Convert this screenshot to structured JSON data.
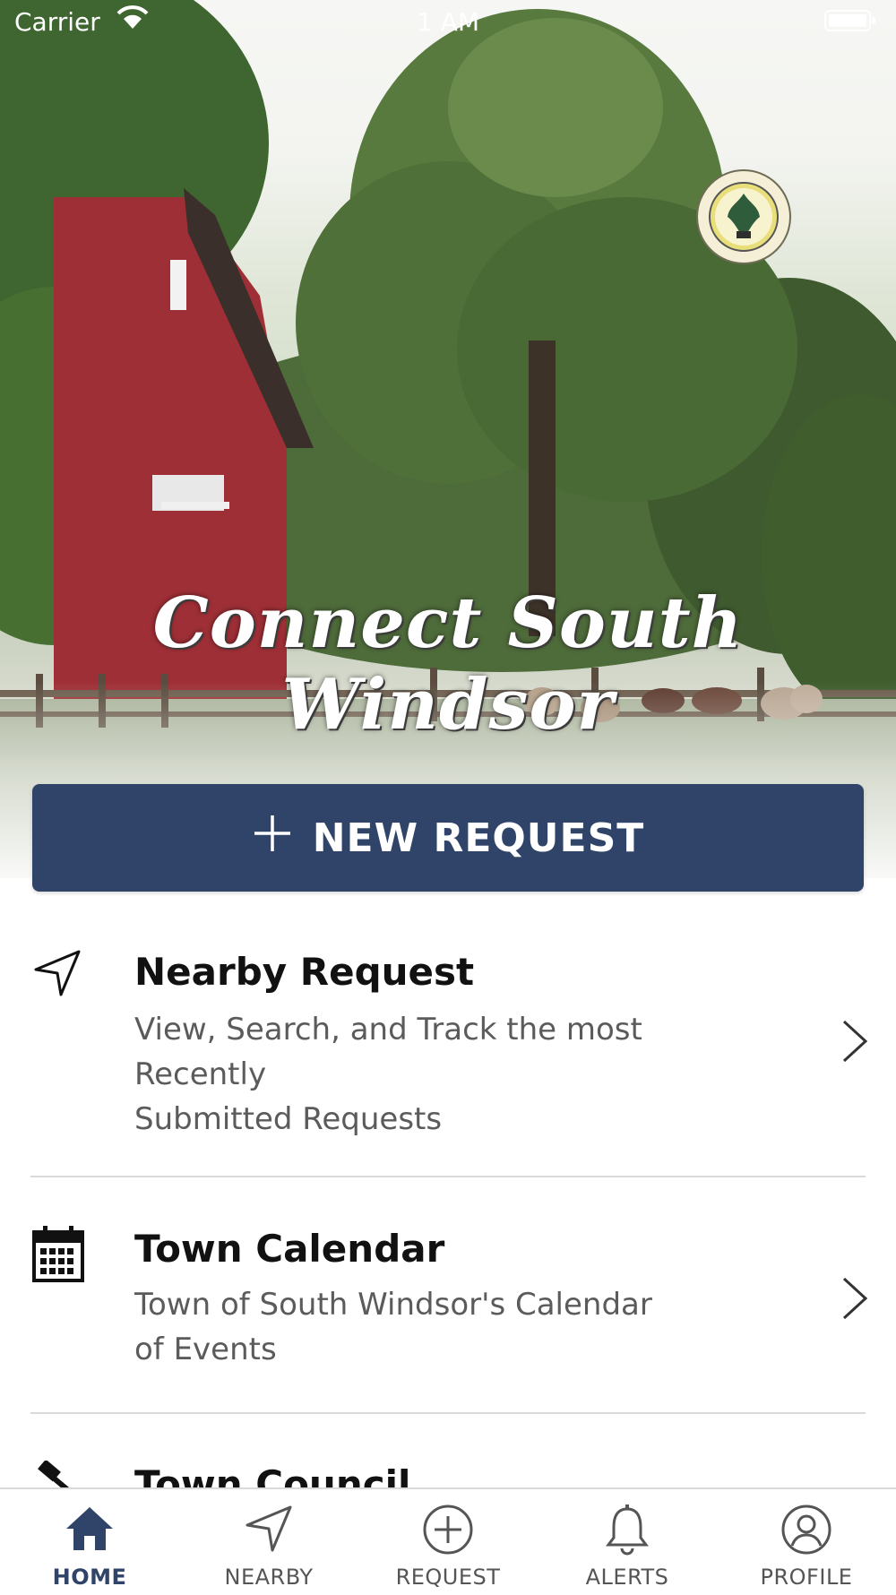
{
  "status_bar": {
    "carrier": "Carrier",
    "time": "1 AM"
  },
  "hero": {
    "app_title": "Connect South Windsor",
    "seal_alt": "Town Seal South Windsor Connecticut"
  },
  "new_request": {
    "label": "NEW REQUEST"
  },
  "list": [
    {
      "title": "Nearby Request",
      "subtitle_line1": "View, Search, and Track the most Recently",
      "subtitle_line2": "Submitted Requests",
      "icon": "location-arrow-icon"
    },
    {
      "title": "Town Calendar",
      "subtitle_line1": "Town of South Windsor's Calendar",
      "subtitle_line2": "of Events",
      "icon": "calendar-icon"
    },
    {
      "title": "Town Council",
      "icon": "gavel-icon"
    }
  ],
  "tabs": [
    {
      "label": "HOME",
      "icon": "home-icon",
      "active": true
    },
    {
      "label": "NEARBY",
      "icon": "location-arrow-icon",
      "active": false
    },
    {
      "label": "REQUEST",
      "icon": "plus-circle-icon",
      "active": false
    },
    {
      "label": "ALERTS",
      "icon": "bell-icon",
      "active": false
    },
    {
      "label": "PROFILE",
      "icon": "user-circle-icon",
      "active": false
    }
  ],
  "colors": {
    "primary": "#2f4468",
    "barn_red": "#9e2f36",
    "divider": "#d9d9d9"
  }
}
